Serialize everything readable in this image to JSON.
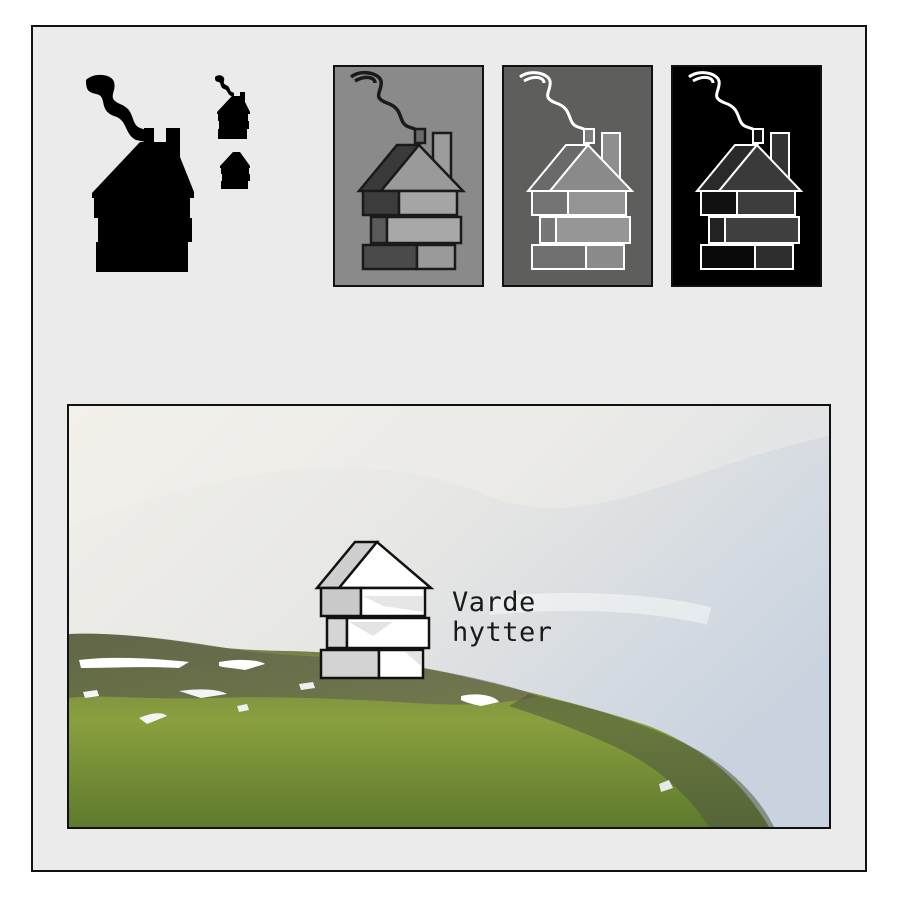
{
  "brand": {
    "name_line1": "Varde",
    "name_line2": "hytter"
  },
  "colors": {
    "board_background": "#ebebeb",
    "border": "#111111",
    "tile_light_grey": "#8a8a8a",
    "tile_dark_grey": "#5e5f5d",
    "tile_black": "#000000"
  },
  "icons": {
    "large_logo": "cabin-with-smoke-silhouette-icon",
    "small_logo": "cabin-with-smoke-small-icon",
    "tiny_logo": "cabin-tiny-icon",
    "photo_logo": "stacked-cabin-icon"
  },
  "photo": {
    "subject": "mountain-slope-with-snow-patches"
  }
}
